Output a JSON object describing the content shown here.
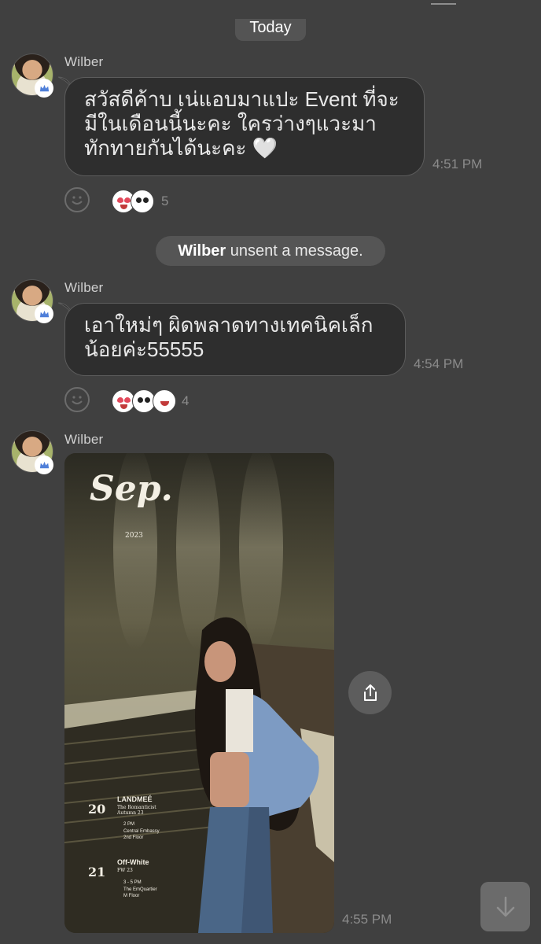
{
  "date_divider": "Today",
  "messages": [
    {
      "sender": "Wilber",
      "lines": [
        "สวัสดีค้าบ เน่แอบมาแปะ Event ที่จะ",
        "มีในเดือนนี้นะคะ ใครว่างๆแวะมา",
        "ทักทายกันได้นะคะ 🤍"
      ],
      "time": "4:51 PM",
      "reaction_count": "5"
    },
    {
      "sender": "Wilber",
      "lines": [
        "เอาใหม่ๆ ผิดพลาดทางเทคนิคเล็ก",
        "น้อยค่ะ55555"
      ],
      "time": "4:54 PM",
      "reaction_count": "4"
    },
    {
      "sender": "Wilber",
      "time": "4:55 PM"
    }
  ],
  "system_notice": {
    "name": "Wilber",
    "text": " unsent a message."
  },
  "poster": {
    "month": "Sep.",
    "year": "2023",
    "event1": {
      "day": "20",
      "brand": "LANDMEÉ",
      "subtitle": "The Romanticist Autumn 23",
      "time": "2 PM",
      "place": "Central Embassy",
      "floor": "2nd Floor"
    },
    "event2": {
      "day": "21",
      "brand": "Off-White",
      "subtitle": "FW 23",
      "time": "3 - 5 PM",
      "place": "The EmQuartier",
      "floor": "M Floor"
    }
  },
  "icons": {
    "badge": "crown-icon",
    "share": "share-icon",
    "scroll": "arrow-down-icon",
    "react": "smiley-icon"
  },
  "colors": {
    "background": "#404040",
    "bubble": "#2e2e2e",
    "pill": "#555555"
  }
}
